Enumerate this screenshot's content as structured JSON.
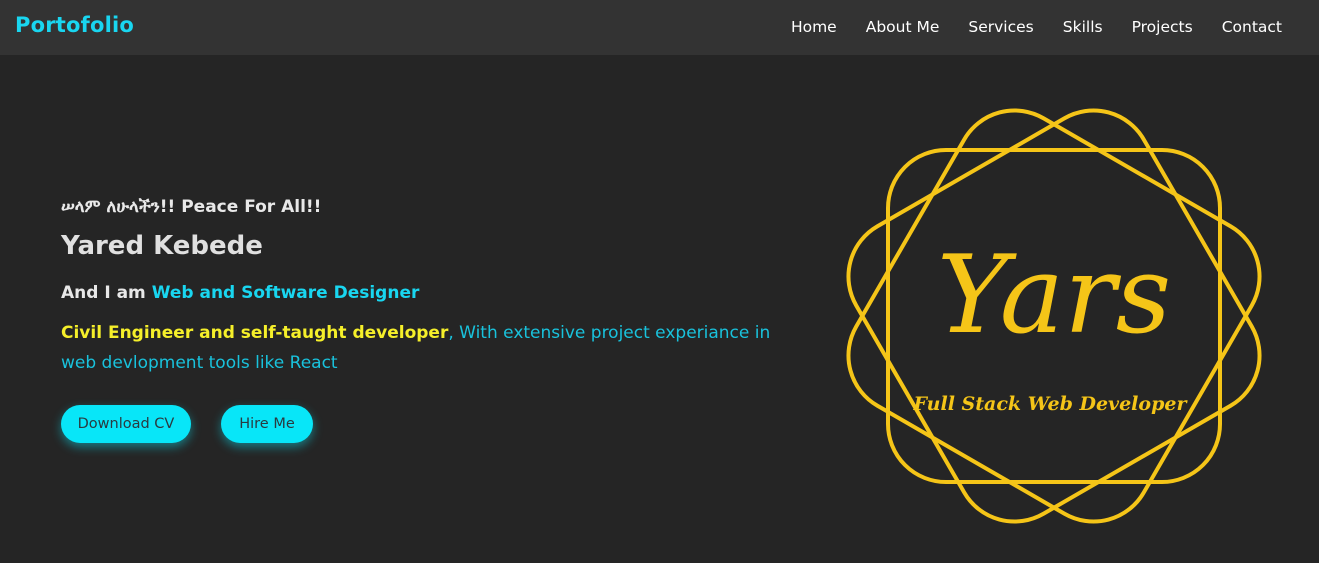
{
  "nav": {
    "brand": "Portofolio",
    "links": [
      "Home",
      "About Me",
      "Services",
      "Skills",
      "Projects",
      "Contact"
    ]
  },
  "hero": {
    "greeting": "ሠላም ለሁላችን!! Peace For All!!",
    "name": "Yared Kebede",
    "role_prefix": "And I am ",
    "role_highlight": "Web and Software Designer",
    "desc_strong": "Civil Engineer and self-taught developer",
    "desc_rest": ", With extensive project experiance in web devlopment tools like React",
    "buttons": {
      "download": "Download CV",
      "hire": "Hire Me"
    }
  },
  "logo": {
    "title": "Yars",
    "subtitle": "Full Stack Web Developer",
    "color": "#f5c518"
  },
  "colors": {
    "accent": "#19d6f0",
    "highlight_yellow": "#f5ef2a",
    "button_bg": "#08e6f8",
    "background": "#252525",
    "navbar": "#333333"
  }
}
